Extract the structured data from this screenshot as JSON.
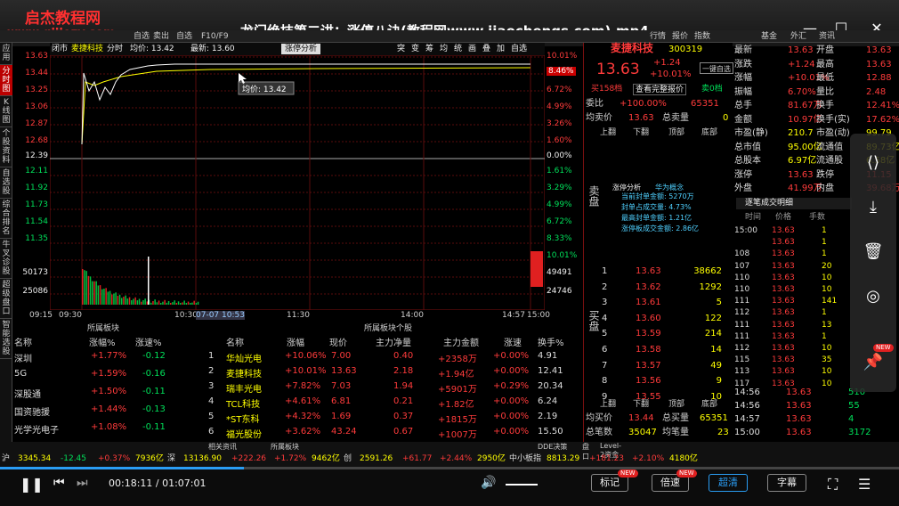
{
  "brand": {
    "name": "启杰教程网",
    "url": "www.qijiezy.com"
  },
  "video_title": "龙门绝技第二讲：涨停八诀(教程网www.jiaochengs.com).mp4",
  "menu": [
    "自选",
    "F10/F9",
    "卖出",
    "自选",
    "F10/F9",
    "卖出",
    "行情",
    "报价",
    "指数",
    "基金",
    "外汇",
    "资讯"
  ],
  "left_nav": [
    "应用",
    "分时图",
    "K线图",
    "个股资料",
    "自选股",
    "综合排名",
    "牛叉诊股",
    "超级盘口",
    "智能选股"
  ],
  "chart_header": {
    "market": "闭市",
    "name": "麦捷科技",
    "mode": "分时",
    "avg_label": "均价: 13.42",
    "last_label": "最新: 13.60",
    "zt_tag": "涨停分析",
    "tools": [
      "突",
      "变",
      "筹",
      "均",
      "统",
      "画",
      "叠",
      "加",
      "自选"
    ]
  },
  "y_left": [
    "13.63",
    "13.44",
    "13.25",
    "13.06",
    "12.87",
    "12.68",
    "12.49",
    "12.39",
    "12.30",
    "12.11",
    "11.92",
    "11.73",
    "11.54",
    "11.35",
    "50173",
    "25086"
  ],
  "y_right": [
    "10.01%",
    "8.46%",
    "6.72%",
    "4.99%",
    "3.26%",
    "1.60%",
    "0.00%",
    "1.61%",
    "3.29%",
    "4.99%",
    "6.72%",
    "8.33%",
    "10.01%",
    "49491",
    "24746"
  ],
  "x_labels": [
    "09:15",
    "09:30",
    "10:30",
    "07-07 10:53",
    "11:30",
    "14:00",
    "14:57",
    "15:00"
  ],
  "avg_tooltip": "均价: 13.42",
  "quote": {
    "name": "麦捷科技",
    "code": "300319",
    "price": "13.63",
    "chg": "+1.24",
    "pct": "+10.01%",
    "btn_add": "一键自选",
    "tab_buy": "买158档",
    "tab_complete": "查看完整报价",
    "tab_sell": "卖0档",
    "weibi_label": "委比",
    "weibi": "+100.00%",
    "weicha": "65351",
    "junmai_label": "均卖价",
    "junmai": "13.63",
    "zongmai_label": "总卖量",
    "zongmai": "0",
    "nav": [
      "上翻",
      "下翻",
      "顶部",
      "底部"
    ],
    "sell_label": "卖盘",
    "buy_label": "买盘",
    "zt_title": "涨停分析",
    "zt_concept": "华为概念",
    "zt_lines": [
      "当前封单金额: 5270万",
      "封单占成交量: 4.73%",
      "最高封单金额: 1.21亿",
      "涨停板成交金额: 2.86亿"
    ],
    "junmai2_label": "均买价",
    "junmai2": "13.44",
    "zongmai2_label": "总买量",
    "zongmai2": "65351",
    "zongbi_label": "总笔数",
    "zongbi": "35047",
    "jiebi_label": "均笔量",
    "jiebi": "23"
  },
  "buy_levels": [
    [
      "1",
      "13.63",
      "38662"
    ],
    [
      "2",
      "13.62",
      "1292"
    ],
    [
      "3",
      "13.61",
      "5"
    ],
    [
      "4",
      "13.60",
      "122"
    ],
    [
      "5",
      "13.59",
      "214"
    ],
    [
      "6",
      "13.58",
      "14"
    ],
    [
      "7",
      "13.57",
      "49"
    ],
    [
      "8",
      "13.56",
      "9"
    ],
    [
      "9",
      "13.55",
      "10"
    ]
  ],
  "stats": [
    [
      "最新",
      "13.63",
      "开盘",
      "13.63"
    ],
    [
      "涨跌",
      "+1.24",
      "最高",
      "13.63"
    ],
    [
      "涨幅",
      "+10.01%",
      "最低",
      "12.88"
    ],
    [
      "振幅",
      "6.70%",
      "量比",
      "2.48"
    ],
    [
      "总手",
      "81.67万",
      "换手",
      "12.41%"
    ],
    [
      "金额",
      "10.97亿",
      "换手(实)",
      "17.62%"
    ],
    [
      "市盈(静)",
      "210.7",
      "市盈(动)",
      "99.79"
    ],
    [
      "总市值",
      "95.00亿",
      "流通值",
      "89.73亿"
    ],
    [
      "总股本",
      "6.97亿",
      "流通股",
      "6.58亿"
    ],
    [
      "涨停",
      "13.63",
      "跌停",
      "11.15"
    ],
    [
      "外盘",
      "41.99万",
      "内盘",
      "39.68万"
    ]
  ],
  "tick_title": "逐笔成交明细",
  "tick_head": [
    "时间",
    "价格",
    "手数"
  ],
  "ticks": [
    [
      "15:00",
      "13.63",
      "1"
    ],
    [
      "",
      "13.63",
      "1"
    ],
    [
      "108",
      "13.63",
      "1"
    ],
    [
      "107",
      "13.63",
      "20"
    ],
    [
      "110",
      "13.63",
      "10"
    ],
    [
      "110",
      "13.63",
      "10"
    ],
    [
      "111",
      "13.63",
      "141"
    ],
    [
      "112",
      "13.63",
      "1"
    ],
    [
      "111",
      "13.63",
      "13"
    ],
    [
      "111",
      "13.63",
      "1"
    ],
    [
      "112",
      "13.63",
      "10"
    ],
    [
      "115",
      "13.63",
      "35"
    ],
    [
      "113",
      "13.63",
      "10"
    ],
    [
      "117",
      "13.63",
      "10"
    ]
  ],
  "tick_bottom": [
    [
      "14:56",
      "13.63",
      "510"
    ],
    [
      "14:56",
      "13.63",
      "55"
    ],
    [
      "14:57",
      "13.63",
      "4"
    ],
    [
      "15:00",
      "13.63",
      "3172"
    ]
  ],
  "sector_title": "所属板块",
  "stocks_title": "所属板块个股",
  "sector_head": [
    "名称",
    "涨幅%",
    "涨速%"
  ],
  "sectors": [
    [
      "深圳",
      "+1.77%",
      "-0.12"
    ],
    [
      "5G",
      "+1.59%",
      "-0.16"
    ],
    [
      "深股通",
      "+1.50%",
      "-0.11"
    ],
    [
      "国资驰援",
      "+1.44%",
      "-0.13"
    ],
    [
      "光学光电子",
      "+1.08%",
      "-0.11"
    ]
  ],
  "stock_head": [
    "名称",
    "涨幅",
    "现价",
    "主力净量",
    "主力金额",
    "涨速",
    "换手%"
  ],
  "stocks": [
    [
      "1",
      "华灿光电",
      "+10.06%",
      "7.00",
      "0.40",
      "+2358万",
      "+0.00%",
      "4.91"
    ],
    [
      "2",
      "麦捷科技",
      "+10.01%",
      "13.63",
      "2.18",
      "+1.94亿",
      "+0.00%",
      "12.41"
    ],
    [
      "3",
      "瑞丰光电",
      "+7.82%",
      "7.03",
      "1.94",
      "+5901万",
      "+0.29%",
      "20.34"
    ],
    [
      "4",
      "TCL科技",
      "+4.61%",
      "6.81",
      "0.21",
      "+1.82亿",
      "+0.00%",
      "6.24"
    ],
    [
      "5",
      "*ST东科",
      "+4.32%",
      "1.69",
      "0.37",
      "+1815万",
      "+0.00%",
      "2.19"
    ],
    [
      "6",
      "福光股份",
      "+3.62%",
      "43.24",
      "0.67",
      "+1007万",
      "+0.00%",
      "15.50"
    ]
  ],
  "status": [
    "沪",
    "3345.34",
    "-12.45",
    "+0.37%",
    "7936亿",
    "深",
    "13136.90",
    "+222.26",
    "+1.72%",
    "9462亿",
    "创",
    "2591.26",
    "+61.77",
    "+2.44%",
    "2950亿",
    "中小板指",
    "8813.29",
    "+181.23",
    "+2.10%",
    "4180亿"
  ],
  "bottom_tabs": [
    "相关资讯",
    "所属板块",
    "DDE决策",
    "盘口",
    "Level-2资金"
  ],
  "player": {
    "time": "00:18:11 / 01:07:01",
    "btns": [
      "标记",
      "倍速",
      "超清",
      "字幕"
    ],
    "new": "NEW"
  },
  "colors": {
    "up": "#ff3b3b",
    "down": "#00e05a",
    "accent": "#ffff00"
  }
}
